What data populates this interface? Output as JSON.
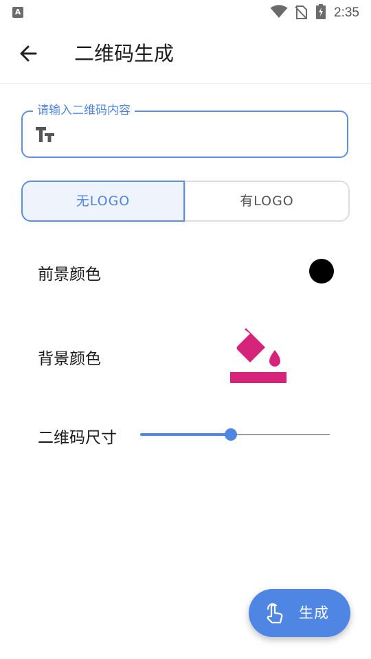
{
  "status_bar": {
    "time": "2:35",
    "left_icon_letter": "A"
  },
  "app_bar": {
    "title": "二维码生成",
    "back_icon": "arrow-back-icon"
  },
  "input": {
    "label": "请输入二维码内容",
    "value": "",
    "icon": "text-fields-icon"
  },
  "logo_toggle": {
    "options": [
      "无LOGO",
      "有LOGO"
    ],
    "selected": "无LOGO"
  },
  "foreground": {
    "label": "前景颜色",
    "color": "#000000"
  },
  "background": {
    "label": "背景颜色",
    "icon": "paint-bucket-icon",
    "color": "#d6247a"
  },
  "size": {
    "label": "二维码尺寸",
    "value_fraction": 0.48
  },
  "fab": {
    "label": "生成",
    "icon": "touch-hand-icon"
  },
  "colors": {
    "accent": "#4f86e4",
    "bucket": "#d6247a"
  }
}
